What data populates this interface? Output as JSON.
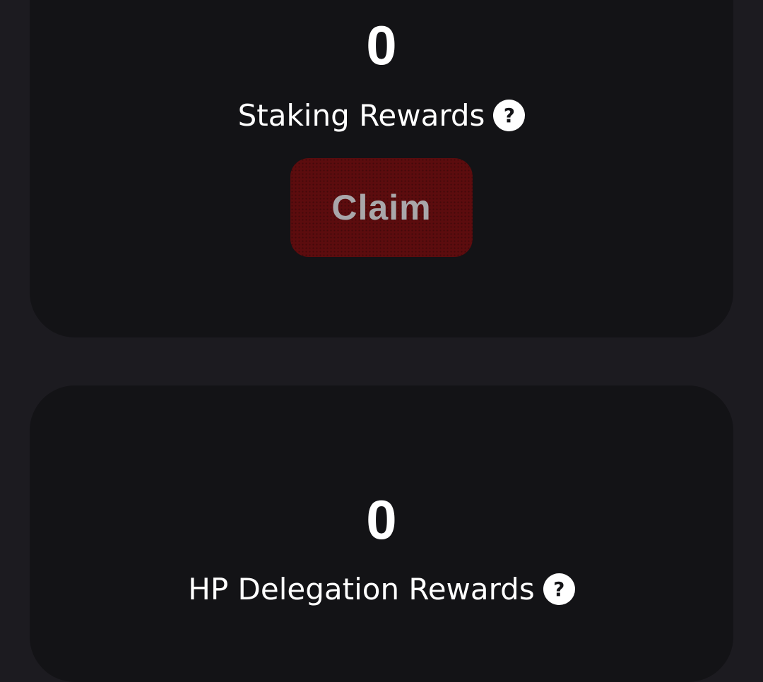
{
  "staking": {
    "amount": "0",
    "label": "Staking Rewards",
    "help_glyph": "?",
    "claim_label": "Claim"
  },
  "hp_delegation": {
    "amount": "0",
    "label": "HP Delegation Rewards",
    "help_glyph": "?"
  },
  "colors": {
    "page_background": "#1c1b20",
    "card_background": "#131316",
    "claim_button_background": "#5c0c0e",
    "claim_button_text": "#a9a7aa",
    "text": "#ffffff"
  },
  "icons": {
    "help": "help-icon"
  }
}
